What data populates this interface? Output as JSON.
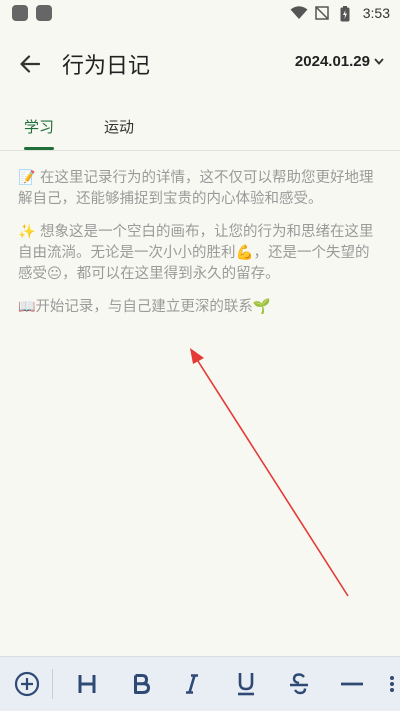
{
  "status_bar": {
    "time": "3:53"
  },
  "header": {
    "title": "行为日记",
    "date": "2024.01.29"
  },
  "tabs": [
    {
      "label": "学习",
      "active": true
    },
    {
      "label": "运动",
      "active": false
    }
  ],
  "editor": {
    "paragraphs": [
      {
        "emoji": "📝",
        "text": " 在这里记录行为的详情，这不仅可以帮助您更好地理解自己，还能够捕捉到宝贵的内心体验和感受。"
      },
      {
        "emoji": "✨",
        "text": " 想象这是一个空白的画布，让您的行为和思绪在这里自由流淌。无论是一次小小的胜利💪，还是一个失望的感受😐，都可以在这里得到永久的留存。"
      },
      {
        "emoji": "📖",
        "text": "开始记录，与自己建立更深的联系🌱"
      }
    ]
  },
  "toolbar": {
    "items": [
      {
        "name": "add",
        "glyph": "⊕"
      },
      {
        "name": "heading",
        "glyph": "H"
      },
      {
        "name": "bold",
        "glyph": "B"
      },
      {
        "name": "italic",
        "glyph": "I"
      },
      {
        "name": "underline",
        "glyph": "U"
      },
      {
        "name": "strikethrough",
        "glyph": "S"
      },
      {
        "name": "divider",
        "glyph": "—"
      },
      {
        "name": "list",
        "glyph": "☰"
      }
    ]
  },
  "colors": {
    "accent": "#1f6f3a",
    "toolbar_icon": "#2e4a74",
    "annotation_arrow": "#e53935"
  }
}
